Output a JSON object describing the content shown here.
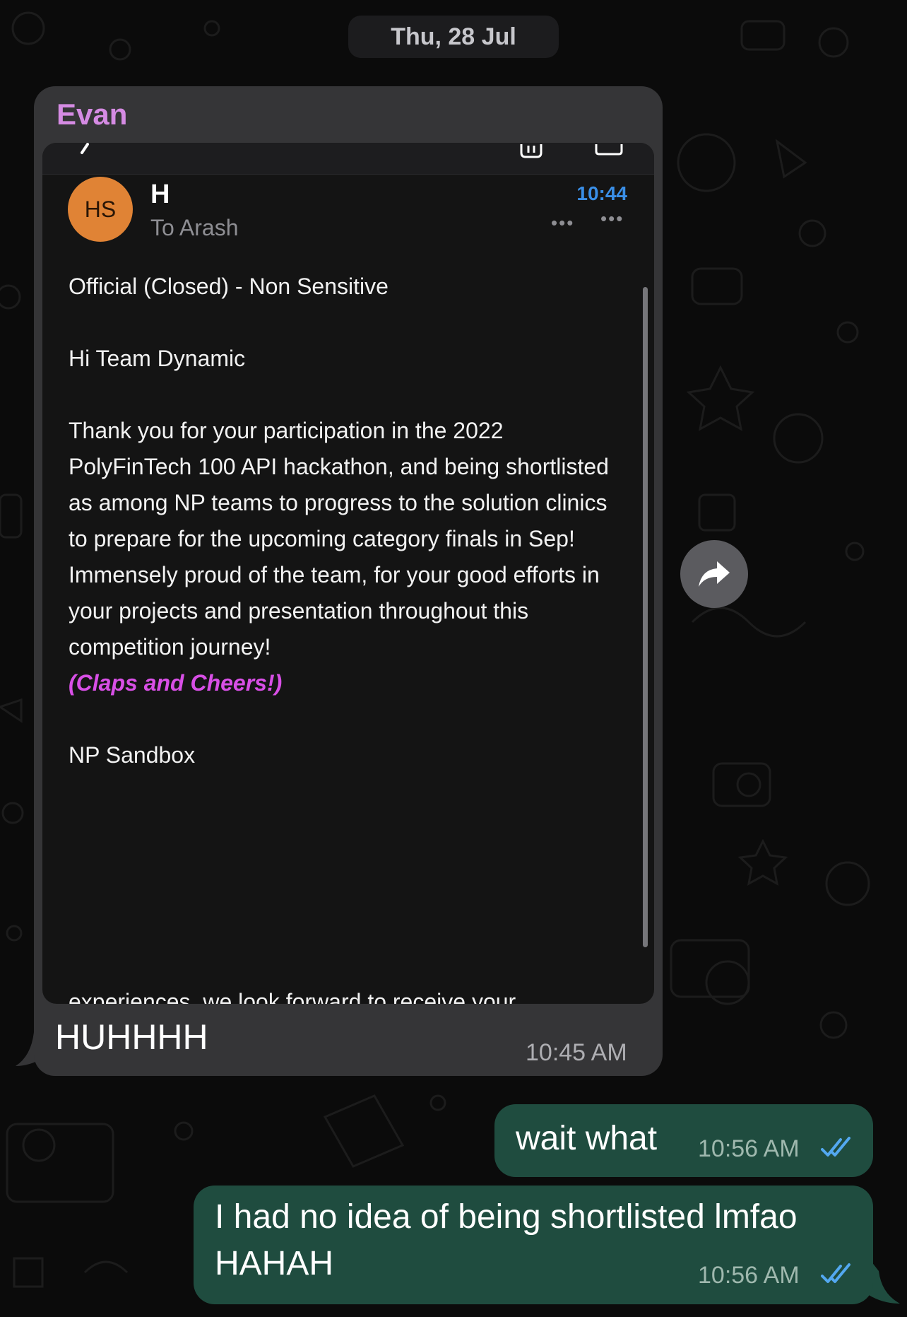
{
  "date_separator": "Thu, 28 Jul",
  "incoming": {
    "sender": "Evan",
    "email_screenshot": {
      "avatar_initials": "HS",
      "from": "H",
      "to": "To Arash",
      "time": "10:44",
      "paragraphs": [
        "Official (Closed) - Non Sensitive",
        "Hi Team Dynamic",
        "Thank you for your participation in the 2022 PolyFinTech 100 API hackathon, and being shortlisted as among NP teams to progress to the solution clinics to prepare for the upcoming category finals in Sep! Immensely proud of the team, for your good efforts in your projects and presentation throughout this competition journey!",
        "NP Sandbox"
      ],
      "highlight": "(Claps and Cheers!)",
      "cutoff_text": "experiences, we look forward to receive your"
    },
    "text": "HUHHHH",
    "time": "10:45 AM"
  },
  "outgoing": [
    {
      "text": "wait what",
      "time": "10:56 AM"
    },
    {
      "text_line1": "I had no idea of being shortlisted lmfao",
      "text_line2": "HAHAH",
      "time": "10:56 AM"
    }
  ],
  "icons": {
    "forward": "forward-arrow-icon",
    "read_receipt": "double-check-icon"
  },
  "colors": {
    "accent_sender": "#d58be3",
    "outgoing_bubble": "#1f4c3f",
    "incoming_bubble": "#353537",
    "read_ticks": "#53a8f0"
  }
}
